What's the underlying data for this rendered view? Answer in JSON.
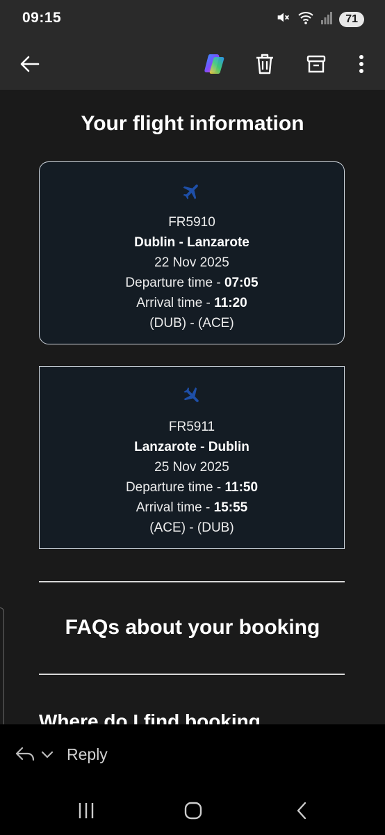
{
  "status_bar": {
    "time": "09:15",
    "icons": [
      "mute-icon",
      "wifi-icon",
      "signal-icon"
    ],
    "battery": "71"
  },
  "toolbar": {
    "back_icon": "arrow-left-icon",
    "actions": [
      "copilot-icon",
      "trash-icon",
      "archive-icon",
      "more-vertical-icon"
    ]
  },
  "email": {
    "section_title": "Your flight information",
    "flights": [
      {
        "number": "FR5910",
        "route": "Dublin - Lanzarote",
        "date": "22 Nov 2025",
        "departure_label": "Departure time - ",
        "departure_time": "07:05",
        "arrival_label": "Arrival time - ",
        "arrival_time": "11:20",
        "airports": "(DUB) - (ACE)"
      },
      {
        "number": "FR5911",
        "route": "Lanzarote - Dublin",
        "date": "25 Nov 2025",
        "departure_label": "Departure time - ",
        "departure_time": "11:50",
        "arrival_label": "Arrival time - ",
        "arrival_time": "15:55",
        "airports": "(ACE) - (DUB)"
      }
    ],
    "faq_title": "FAQs about your booking",
    "faq_question_partial": "Where do I find booking"
  },
  "reply_bar": {
    "label": "Reply"
  },
  "colors": {
    "plane": "#1e4fa8",
    "background": "#1a1a1a",
    "card": "#141c24"
  }
}
